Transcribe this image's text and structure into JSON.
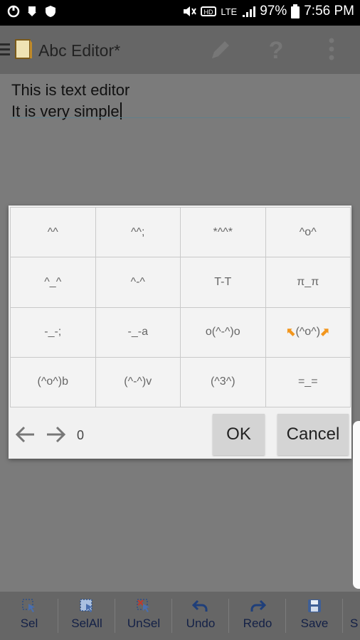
{
  "status_bar": {
    "battery": "97%",
    "time": "7:56 PM",
    "network": "LTE"
  },
  "app_bar": {
    "title": "Abc Editor*"
  },
  "editor": {
    "lines": [
      "This is text editor",
      "It is very simple"
    ]
  },
  "dialog": {
    "cells": [
      "^^",
      "^^;",
      "*^^*",
      "^o^",
      "^_^",
      "^-^",
      "T-T",
      "π_π",
      "-_-;",
      "-_-a",
      "o(^-^)o",
      "(^o^)",
      "(^o^)b",
      "(^-^)v",
      "(^3^)",
      "=_="
    ],
    "counter": "0",
    "ok_label": "OK",
    "cancel_label": "Cancel"
  },
  "toolbar": {
    "items": [
      {
        "label": "Sel",
        "icon": "select-icon"
      },
      {
        "label": "SelAll",
        "icon": "select-all-icon"
      },
      {
        "label": "UnSel",
        "icon": "unselect-icon"
      },
      {
        "label": "Undo",
        "icon": "undo-icon"
      },
      {
        "label": "Redo",
        "icon": "redo-icon"
      },
      {
        "label": "Save",
        "icon": "save-icon"
      },
      {
        "label": "S",
        "icon": "more-icon"
      }
    ]
  },
  "colors": {
    "accent_orange": "#f2961d",
    "overlay": "#7b7b7b",
    "toolbar_text": "#132046"
  }
}
